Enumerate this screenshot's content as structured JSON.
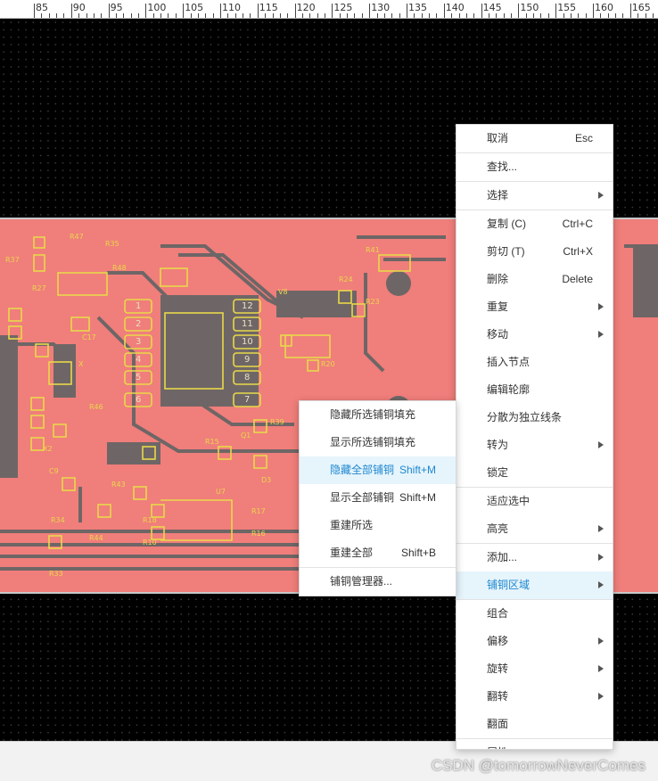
{
  "ruler": {
    "labels": [
      "85",
      "90",
      "95",
      "100",
      "105",
      "110",
      "115",
      "120",
      "125",
      "130",
      "135",
      "140",
      "145",
      "150",
      "155",
      "160",
      "165"
    ]
  },
  "pcb": {
    "designators": [
      "R47",
      "R35",
      "R48",
      "R41",
      "R24",
      "R23",
      "V8",
      "R20",
      "C17",
      "R37",
      "R27",
      "X",
      "R46",
      "R39",
      "R15",
      "Q1",
      "D3",
      "U7",
      "R17",
      "R16",
      "R18",
      "R10",
      "R43",
      "R34",
      "R44",
      "R33",
      "C9",
      "X2"
    ],
    "pins": [
      "1",
      "2",
      "3",
      "4",
      "5",
      "6",
      "12",
      "11",
      "10",
      "9",
      "8",
      "7"
    ]
  },
  "main_menu": [
    {
      "label": "取消",
      "shortcut": "Esc"
    },
    {
      "sep": true
    },
    {
      "label": "查找..."
    },
    {
      "sep": true
    },
    {
      "label": "选择",
      "submenu": true
    },
    {
      "sep": true
    },
    {
      "label": "复制 (C)",
      "shortcut": "Ctrl+C"
    },
    {
      "label": "剪切 (T)",
      "shortcut": "Ctrl+X"
    },
    {
      "label": "删除",
      "shortcut": "Delete"
    },
    {
      "label": "重复",
      "submenu": true
    },
    {
      "label": "移动",
      "submenu": true
    },
    {
      "label": "插入节点"
    },
    {
      "label": "编辑轮廓"
    },
    {
      "label": "分散为独立线条"
    },
    {
      "label": "转为",
      "submenu": true
    },
    {
      "label": "锁定"
    },
    {
      "sep": true
    },
    {
      "label": "适应选中"
    },
    {
      "label": "高亮",
      "submenu": true
    },
    {
      "sep": true
    },
    {
      "label": "添加...",
      "submenu": true
    },
    {
      "label": "铺铜区域",
      "submenu": true,
      "highlighted": true
    },
    {
      "sep": true
    },
    {
      "label": "组合"
    },
    {
      "label": "偏移",
      "submenu": true
    },
    {
      "label": "旋转",
      "submenu": true
    },
    {
      "label": "翻转",
      "submenu": true
    },
    {
      "label": "翻面"
    },
    {
      "sep": true
    },
    {
      "label": "属性..."
    }
  ],
  "sub_menu": [
    {
      "label": "隐藏所选铺铜填充"
    },
    {
      "label": "显示所选铺铜填充"
    },
    {
      "label": "隐藏全部铺铜",
      "shortcut": "Shift+M",
      "highlighted": true
    },
    {
      "label": "显示全部铺铜",
      "shortcut": "Shift+M"
    },
    {
      "label": "重建所选"
    },
    {
      "label": "重建全部",
      "shortcut": "Shift+B"
    },
    {
      "sep": true
    },
    {
      "label": "铺铜管理器..."
    }
  ],
  "watermark": "CSDN @tomorrowNeverComes",
  "colors": {
    "board": "#f07e7b",
    "silkscreen": "#e8d84a",
    "trace": "#7a6a6a",
    "highlight": "#1e88d0"
  }
}
